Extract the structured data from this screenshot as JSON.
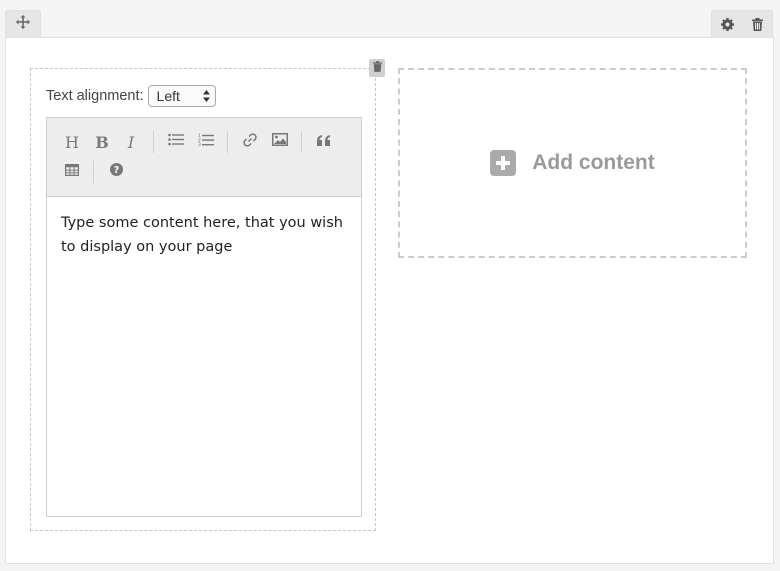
{
  "row_toolbar": {
    "move_icon": "move-icon",
    "settings_icon": "gear-icon",
    "delete_icon": "trash-icon"
  },
  "text_block": {
    "delete_icon": "trash-icon",
    "alignment_label": "Text alignment:",
    "alignment_value": "Left",
    "toolbar": [
      {
        "name": "heading",
        "glyph": "H"
      },
      {
        "name": "bold",
        "glyph": "B"
      },
      {
        "name": "italic",
        "glyph": "I"
      },
      {
        "name": "bullet-list",
        "icon": "bullet-list-icon"
      },
      {
        "name": "numbered-list",
        "icon": "numbered-list-icon"
      },
      {
        "name": "link",
        "icon": "link-icon"
      },
      {
        "name": "image",
        "icon": "image-icon"
      },
      {
        "name": "quote",
        "icon": "quote-icon"
      },
      {
        "name": "table",
        "icon": "table-icon"
      },
      {
        "name": "help",
        "icon": "help-icon"
      }
    ],
    "content": "Type some content here, that you wish to display on your page"
  },
  "add_content": {
    "label": "Add content",
    "icon": "plus-square-icon"
  },
  "colors": {
    "icon_gray": "#777777",
    "dashed_border": "#c6c6c6",
    "add_text": "#9a9a9a"
  }
}
